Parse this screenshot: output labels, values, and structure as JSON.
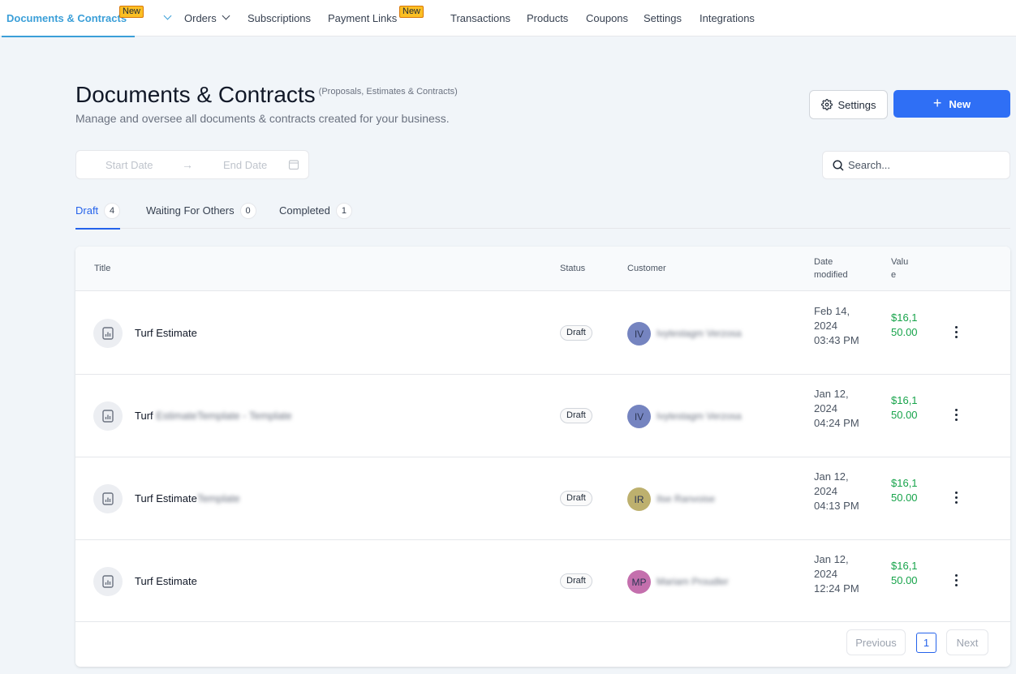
{
  "nav": {
    "items": [
      {
        "label": "Documents & Contracts",
        "badge": "New",
        "active": true,
        "dropdown": true
      },
      {
        "label": "Orders",
        "dropdown": true
      },
      {
        "label": "Subscriptions"
      },
      {
        "label": "Payment Links",
        "badge": "New"
      },
      {
        "label": "Transactions"
      },
      {
        "label": "Products"
      },
      {
        "label": "Coupons"
      },
      {
        "label": "Settings"
      },
      {
        "label": "Integrations"
      }
    ]
  },
  "header": {
    "title": "Documents & Contracts",
    "subtitle": "(Proposals, Estimates & Contracts)",
    "description": "Manage and oversee all documents & contracts created for your business.",
    "settings_label": "Settings",
    "new_label": "New"
  },
  "filters": {
    "start_date_placeholder": "Start Date",
    "end_date_placeholder": "End Date",
    "arrow": "→",
    "search_placeholder": "Search..."
  },
  "tabs": [
    {
      "label": "Draft",
      "count": "4",
      "active": true
    },
    {
      "label": "Waiting For Others",
      "count": "0"
    },
    {
      "label": "Completed",
      "count": "1"
    }
  ],
  "table": {
    "columns": {
      "title": "Title",
      "status": "Status",
      "customer": "Customer",
      "date_line1": "Date",
      "date_line2": "modified",
      "value_line1": "Valu",
      "value_line2": "e"
    },
    "rows": [
      {
        "title": "Turf Estimate",
        "title_blurred": "",
        "status": "Draft",
        "initials": "IV",
        "avatar_color": "#7584c0",
        "customer": "Ivytestagm Verzosa",
        "date": "Feb 14, 2024 03:43 PM",
        "value": "$16,150.00"
      },
      {
        "title": "Turf ",
        "title_blurred": "EstimateTemplate - Template",
        "status": "Draft",
        "initials": "IV",
        "avatar_color": "#7584c0",
        "customer": "Ivytestagm Verzosa",
        "date": "Jan 12, 2024 04:24 PM",
        "value": "$16,150.00"
      },
      {
        "title": "Turf Estimate",
        "title_blurred": "Template",
        "status": "Draft",
        "initials": "IR",
        "avatar_color": "#bdb06e",
        "customer": "Ilse Ranvoise",
        "date": "Jan 12, 2024 04:13 PM",
        "value": "$16,150.00"
      },
      {
        "title": "Turf Estimate",
        "title_blurred": "",
        "status": "Draft",
        "initials": "MP",
        "avatar_color": "#c46fad",
        "customer": "Mariam Proudler",
        "date": "Jan 12, 2024 12:24 PM",
        "value": "$16,150.00"
      }
    ]
  },
  "pagination": {
    "previous_label": "Previous",
    "current_page": "1",
    "next_label": "Next"
  },
  "colors": {
    "accent_nav": "#3b9fd8",
    "primary_button": "#2f6ff5",
    "tab_active": "#2563eb",
    "value_green": "#16a34a",
    "badge_yellow": "#fbbf24"
  }
}
